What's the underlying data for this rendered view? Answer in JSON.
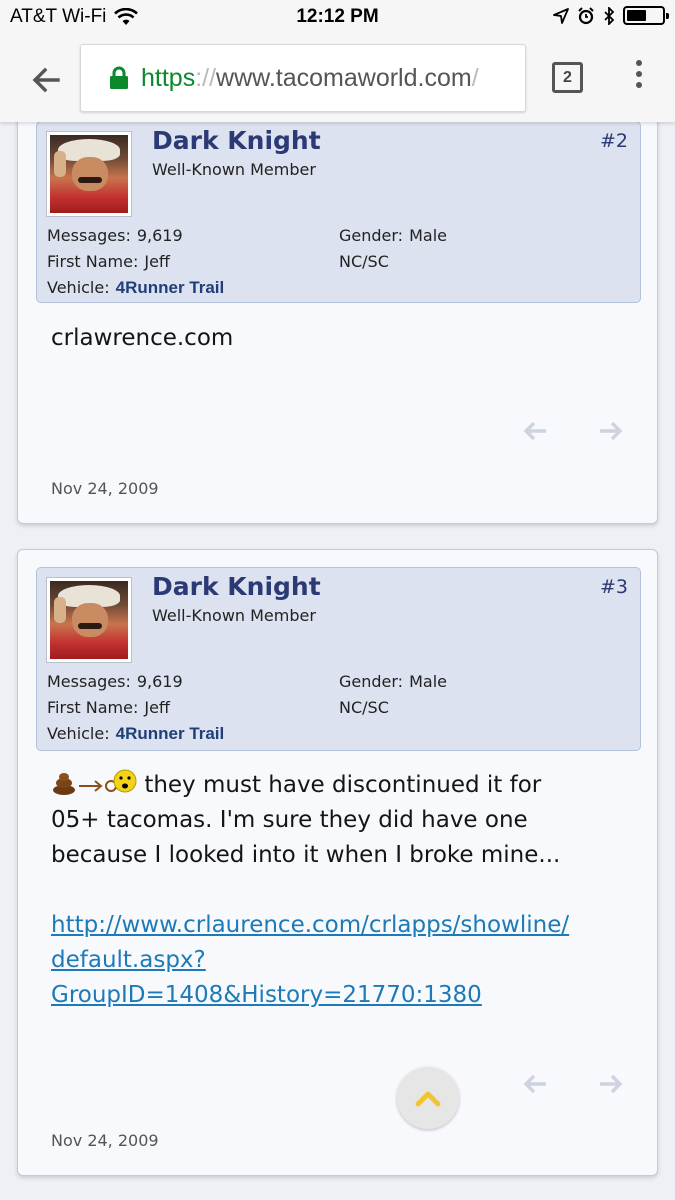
{
  "status_bar": {
    "carrier": "AT&T Wi-Fi",
    "time": "12:12 PM"
  },
  "browser": {
    "url_scheme": "https",
    "url_sep": "://",
    "url_domain": "www.tacomaworld.com",
    "url_tail": "/",
    "tab_count": "2"
  },
  "posts": [
    {
      "username": "Dark Knight",
      "user_title": "Well-Known Member",
      "post_number": "#2",
      "messages_label": "Messages:",
      "messages_value": "9,619",
      "first_name_label": "First Name:",
      "first_name_value": "Jeff",
      "vehicle_label": "Vehicle:",
      "vehicle_value": "4Runner Trail",
      "gender_label": "Gender:",
      "gender_value": "Male",
      "location": "NC/SC",
      "body": "crlawrence.com",
      "date": "Nov 24, 2009"
    },
    {
      "username": "Dark Knight",
      "user_title": "Well-Known Member",
      "post_number": "#3",
      "messages_label": "Messages:",
      "messages_value": "9,619",
      "first_name_label": "First Name:",
      "first_name_value": "Jeff",
      "vehicle_label": "Vehicle:",
      "vehicle_value": "4Runner Trail",
      "gender_label": "Gender:",
      "gender_value": "Male",
      "location": "NC/SC",
      "body_line1": "they must have discontinued it for",
      "body_line2": "05+ tacomas. I'm sure they did have one",
      "body_line3": "because I looked into it when I broke mine...",
      "link_line1": "http://www.crlaurence.com/crlapps/showline/",
      "link_line2": "default.aspx?",
      "link_line3": "GroupID=1408&History=21770:1380",
      "date": "Nov 24, 2009"
    }
  ],
  "icons": {
    "wifi": "wifi-icon",
    "location": "location-arrow-icon",
    "alarm": "alarm-icon",
    "bluetooth": "bluetooth-icon",
    "battery": "battery-icon",
    "back": "back-arrow-icon",
    "lock": "lock-icon",
    "menu": "overflow-menu-icon",
    "prev": "arrow-left-icon",
    "next": "arrow-right-icon",
    "scroll_top": "chevron-up-icon"
  },
  "colors": {
    "username": "#2b3a74",
    "link": "#1c7ab8",
    "secure": "#0a8a2a",
    "userbox_bg": "#dce2ef"
  }
}
